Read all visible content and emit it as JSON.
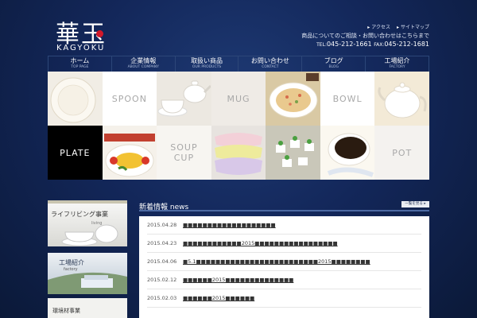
{
  "brand": {
    "kanji": "華玉",
    "name": "KAGYOKU",
    "accent_color": "#d0182a"
  },
  "utility_links": [
    {
      "label": "アクセス"
    },
    {
      "label": "サイトマップ"
    }
  ],
  "contact": {
    "note": "商品についてのご相談・お問い合わせはこちらまで",
    "tel_label": "TEL:",
    "tel": "045-212-1661",
    "fax_label": "FAX:",
    "fax": "045-212-1681"
  },
  "nav": [
    {
      "jp": "ホーム",
      "en": "TOP PAGE"
    },
    {
      "jp": "企業情報",
      "en": "ABOUT COMPANY"
    },
    {
      "jp": "取扱い商品",
      "en": "OUR PRODUCTS"
    },
    {
      "jp": "お問い合わせ",
      "en": "CONTACT"
    },
    {
      "jp": "ブログ",
      "en": "BLOG"
    },
    {
      "jp": "工場紹介",
      "en": "FACTORY"
    }
  ],
  "grid_labels": {
    "spoon": "SPOON",
    "mug": "MUG",
    "bowl": "BOWL",
    "plate": "PLATE",
    "soup_cup": "SOUP CUP",
    "pot": "POT"
  },
  "sidebar": [
    {
      "title": "ライフリビング事業",
      "sub": "living"
    },
    {
      "title": "工場紹介",
      "sub": "factory"
    },
    {
      "title": "環境材事業"
    }
  ],
  "news": {
    "title": "新着情報 news",
    "more_label": "一覧を見る ▸",
    "items": [
      {
        "date": "2015.04.28",
        "text": "■■■■■■■■■■■■■■■■■■■"
      },
      {
        "date": "2015.04.23",
        "text": "■■■■■■■■■■■■2015■■■■■■■■■■■■■■■■■"
      },
      {
        "date": "2015.04.06",
        "text": "■5.1■■■■■■■■■■■■■■■■■■■■■■■■■2015■■■■■■■■"
      },
      {
        "date": "2015.02.12",
        "text": "■■■■■■2015■■■■■■■■■■■■■■"
      },
      {
        "date": "2015.02.03",
        "text": "■■■■■■2015■■■■■■"
      }
    ]
  }
}
